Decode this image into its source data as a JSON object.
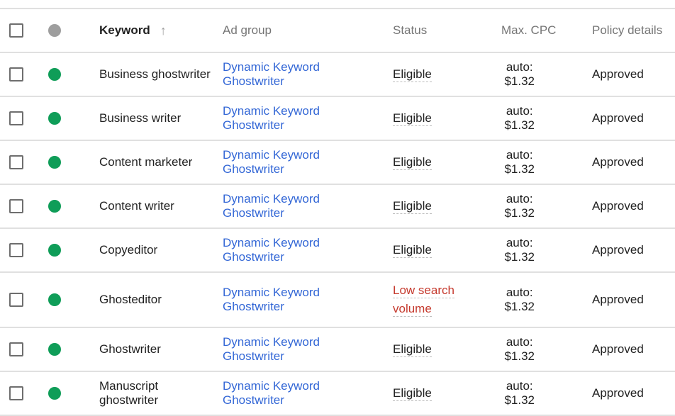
{
  "header": {
    "keyword": "Keyword",
    "sort_icon": "arrow-up-icon",
    "ad_group": "Ad group",
    "status": "Status",
    "max_cpc": "Max. CPC",
    "policy": "Policy details",
    "status_dot_color": "#9e9e9e"
  },
  "colors": {
    "enabled_dot": "#0f9d58",
    "link": "#3367d6",
    "warning": "#c5392d"
  },
  "rows": [
    {
      "keyword": "Business ghostwriter",
      "ad_group": "Dynamic Keyword Ghostwriter",
      "status": "Eligible",
      "status_type": "ok",
      "cpc_label": "auto:",
      "cpc_value": "$1.32",
      "policy": "Approved"
    },
    {
      "keyword": "Business writer",
      "ad_group": "Dynamic Keyword Ghostwriter",
      "status": "Eligible",
      "status_type": "ok",
      "cpc_label": "auto:",
      "cpc_value": "$1.32",
      "policy": "Approved"
    },
    {
      "keyword": "Content marketer",
      "ad_group": "Dynamic Keyword Ghostwriter",
      "status": "Eligible",
      "status_type": "ok",
      "cpc_label": "auto:",
      "cpc_value": "$1.32",
      "policy": "Approved"
    },
    {
      "keyword": "Content writer",
      "ad_group": "Dynamic Keyword Ghostwriter",
      "status": "Eligible",
      "status_type": "ok",
      "cpc_label": "auto:",
      "cpc_value": "$1.32",
      "policy": "Approved"
    },
    {
      "keyword": "Copyeditor",
      "ad_group": "Dynamic Keyword Ghostwriter",
      "status": "Eligible",
      "status_type": "ok",
      "cpc_label": "auto:",
      "cpc_value": "$1.32",
      "policy": "Approved"
    },
    {
      "keyword": "Ghosteditor",
      "ad_group": "Dynamic Keyword Ghostwriter",
      "status": "Low search volume",
      "status_type": "warn",
      "cpc_label": "auto:",
      "cpc_value": "$1.32",
      "policy": "Approved"
    },
    {
      "keyword": "Ghostwriter",
      "ad_group": "Dynamic Keyword Ghostwriter",
      "status": "Eligible",
      "status_type": "ok",
      "cpc_label": "auto:",
      "cpc_value": "$1.32",
      "policy": "Approved"
    },
    {
      "keyword": "Manuscript ghostwriter",
      "ad_group": "Dynamic Keyword Ghostwriter",
      "status": "Eligible",
      "status_type": "ok",
      "cpc_label": "auto:",
      "cpc_value": "$1.32",
      "policy": "Approved"
    }
  ]
}
